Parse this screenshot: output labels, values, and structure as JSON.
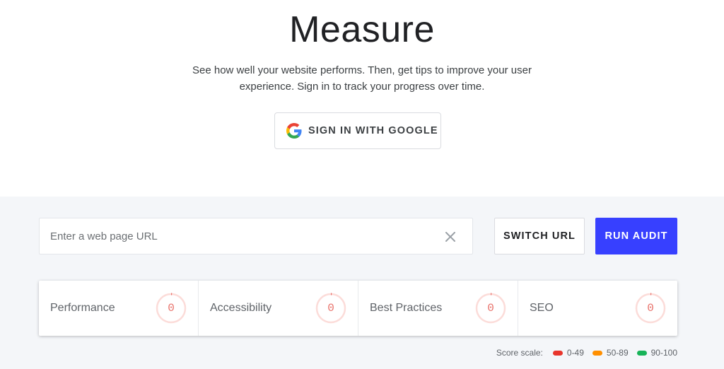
{
  "hero": {
    "title": "Measure",
    "subtitle": "See how well your website performs. Then, get tips to improve your user experience. Sign in to track your progress over time.",
    "google_button": {
      "label": "SIGN IN WITH GOOGLE",
      "icon": "google-g-icon"
    }
  },
  "audit": {
    "url_placeholder": "Enter a web page URL",
    "url_value": "",
    "clear_icon": "close-icon",
    "switch_label": "SWITCH URL",
    "run_label": "RUN AUDIT",
    "run_color": "#3740ff"
  },
  "scores": [
    {
      "label": "Performance",
      "value": "0"
    },
    {
      "label": "Accessibility",
      "value": "0"
    },
    {
      "label": "Best Practices",
      "value": "0"
    },
    {
      "label": "SEO",
      "value": "0"
    }
  ],
  "score_scale": {
    "label": "Score scale:",
    "ranges": [
      {
        "label": "0-49",
        "color": "#e8352c"
      },
      {
        "label": "50-89",
        "color": "#ff8f00"
      },
      {
        "label": "90-100",
        "color": "#17b358"
      }
    ]
  }
}
